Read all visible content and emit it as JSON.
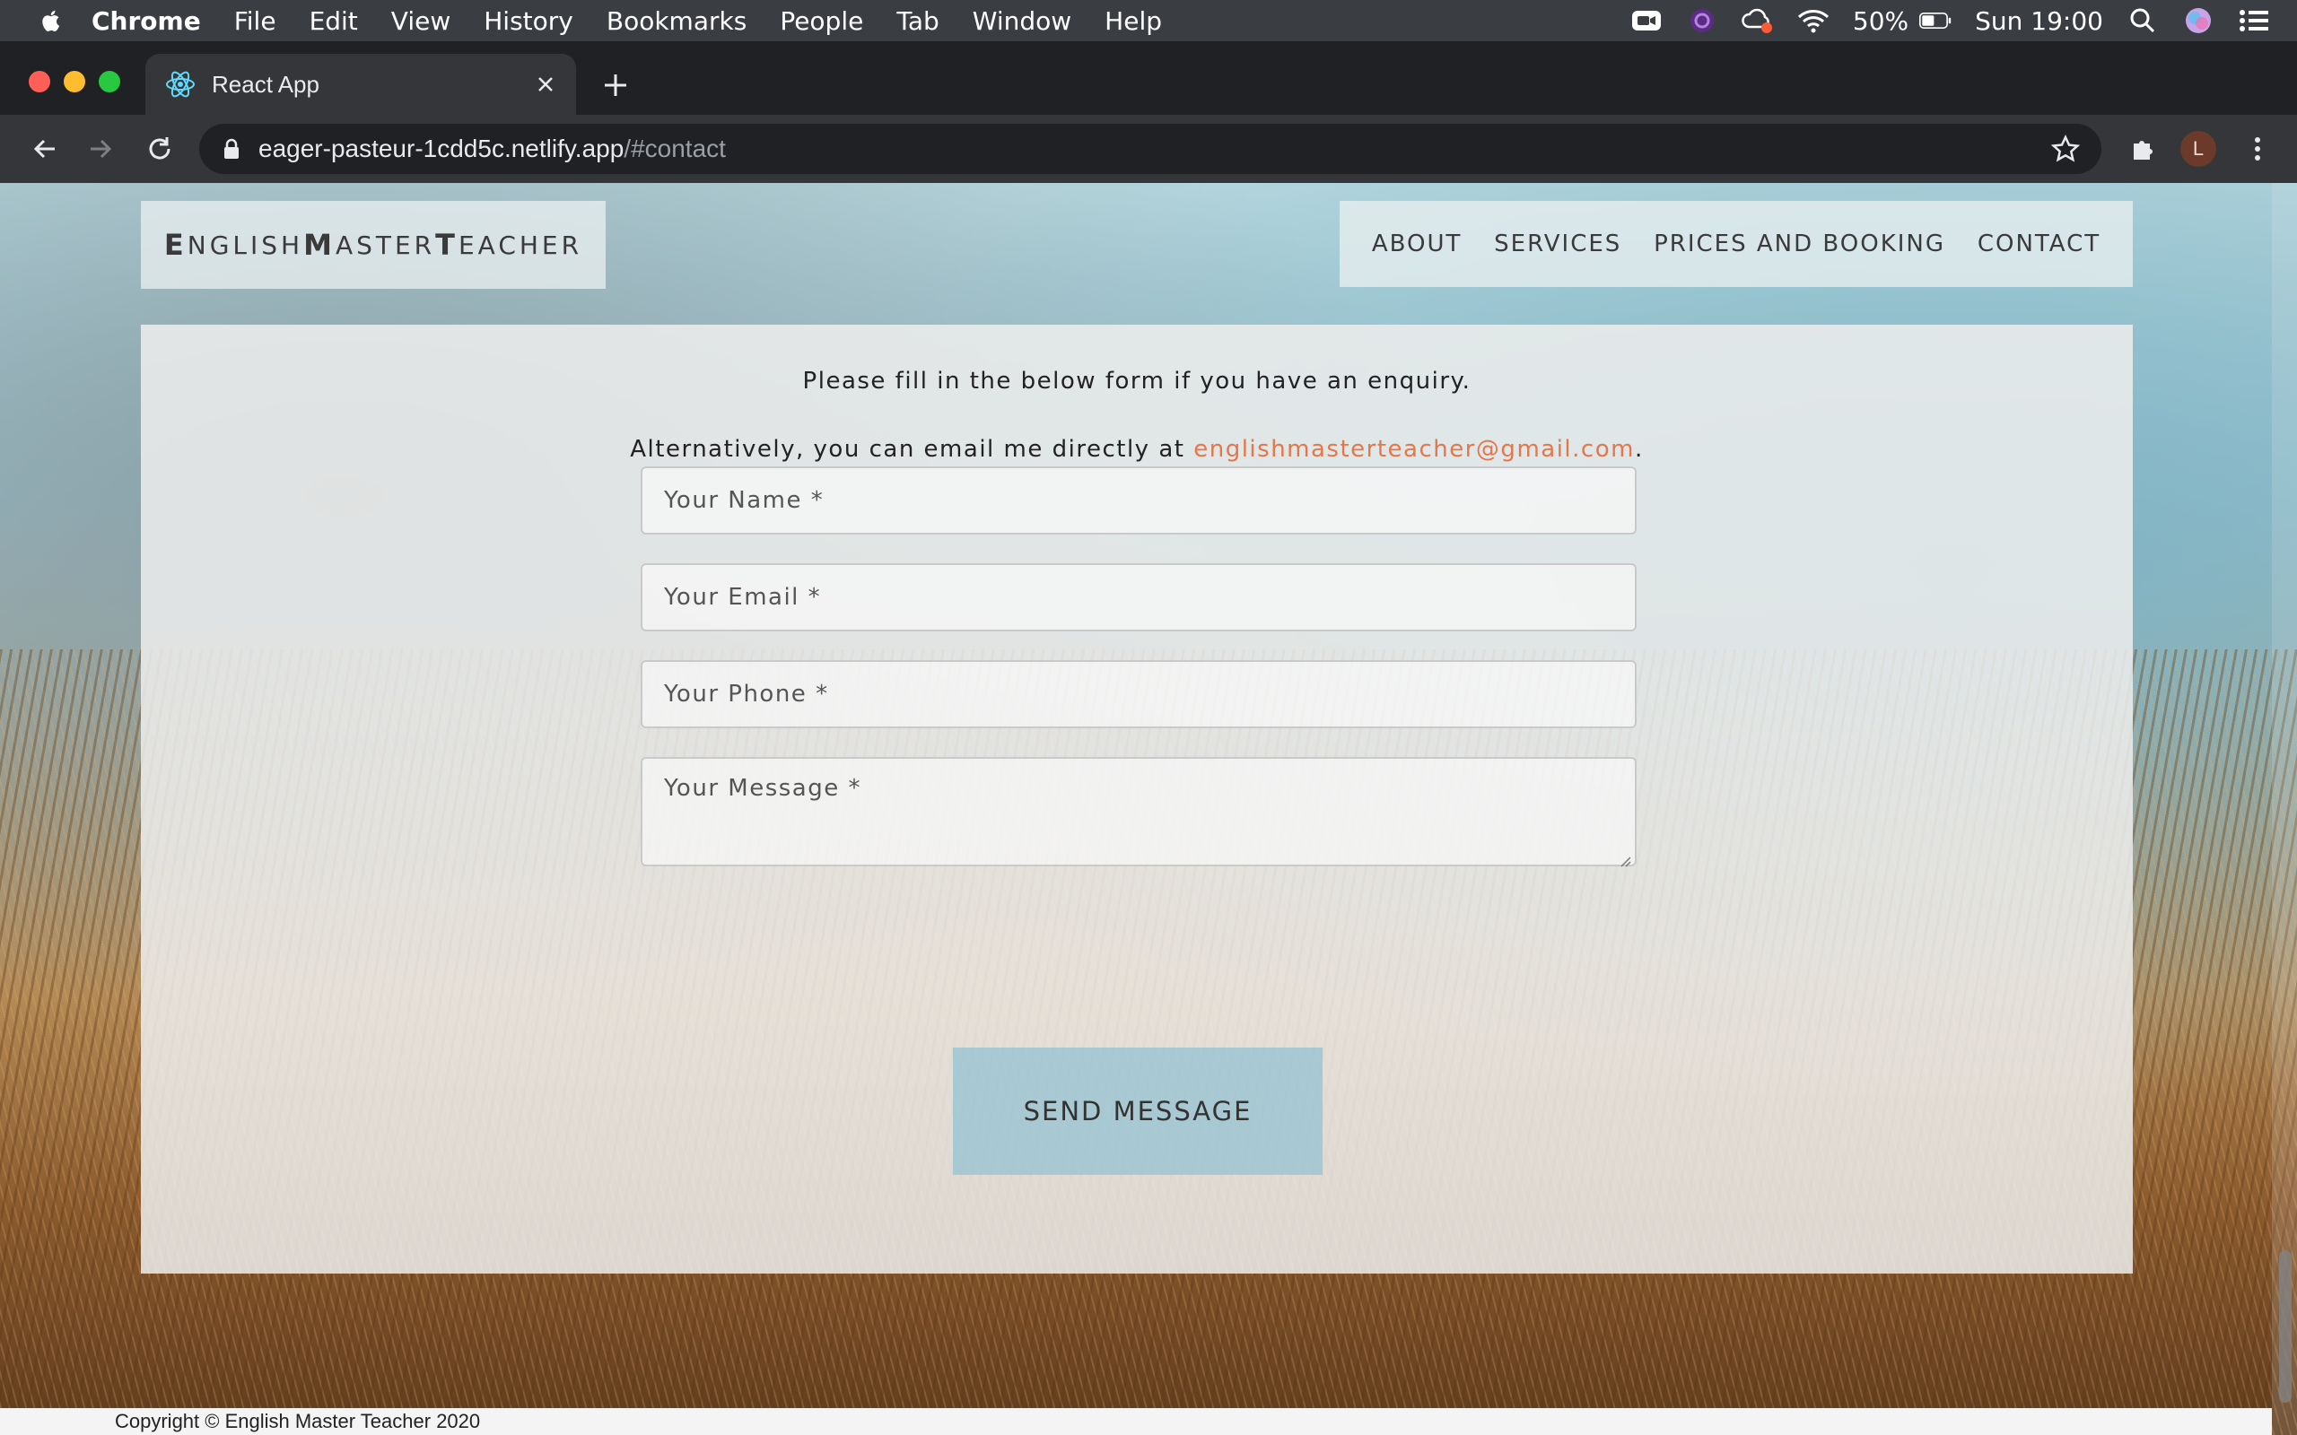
{
  "menubar": {
    "app": "Chrome",
    "items": [
      "File",
      "Edit",
      "View",
      "History",
      "Bookmarks",
      "People",
      "Tab",
      "Window",
      "Help"
    ],
    "battery": "50%",
    "clock": "Sun 19:00"
  },
  "browser": {
    "tab_title": "React App",
    "url_host": "eager-pasteur-1cdd5c.netlify.app",
    "url_path": "/#contact",
    "profile_initial": "L"
  },
  "site": {
    "brand": {
      "e": "E",
      "nglish": "NGLISH ",
      "m": "M",
      "aster": "ASTER ",
      "t": "T",
      "eacher": "EACHER"
    },
    "nav": [
      "ABOUT",
      "SERVICES",
      "PRICES AND BOOKING",
      "CONTACT"
    ]
  },
  "contact": {
    "intro": "Please fill in the below form if you have an enquiry.",
    "alt_prefix": "Alternatively, you can email me directly at ",
    "email": "englishmasterteacher@gmail.com",
    "alt_suffix": ".",
    "fields": {
      "name": "Your Name *",
      "email": "Your Email *",
      "phone": "Your Phone *",
      "message": "Your Message *"
    },
    "send_label": "SEND MESSAGE"
  },
  "footer": {
    "copyright": "Copyright © English Master Teacher 2020"
  },
  "colors": {
    "accent_email": "#e5764a",
    "button": "#94c2d2"
  }
}
